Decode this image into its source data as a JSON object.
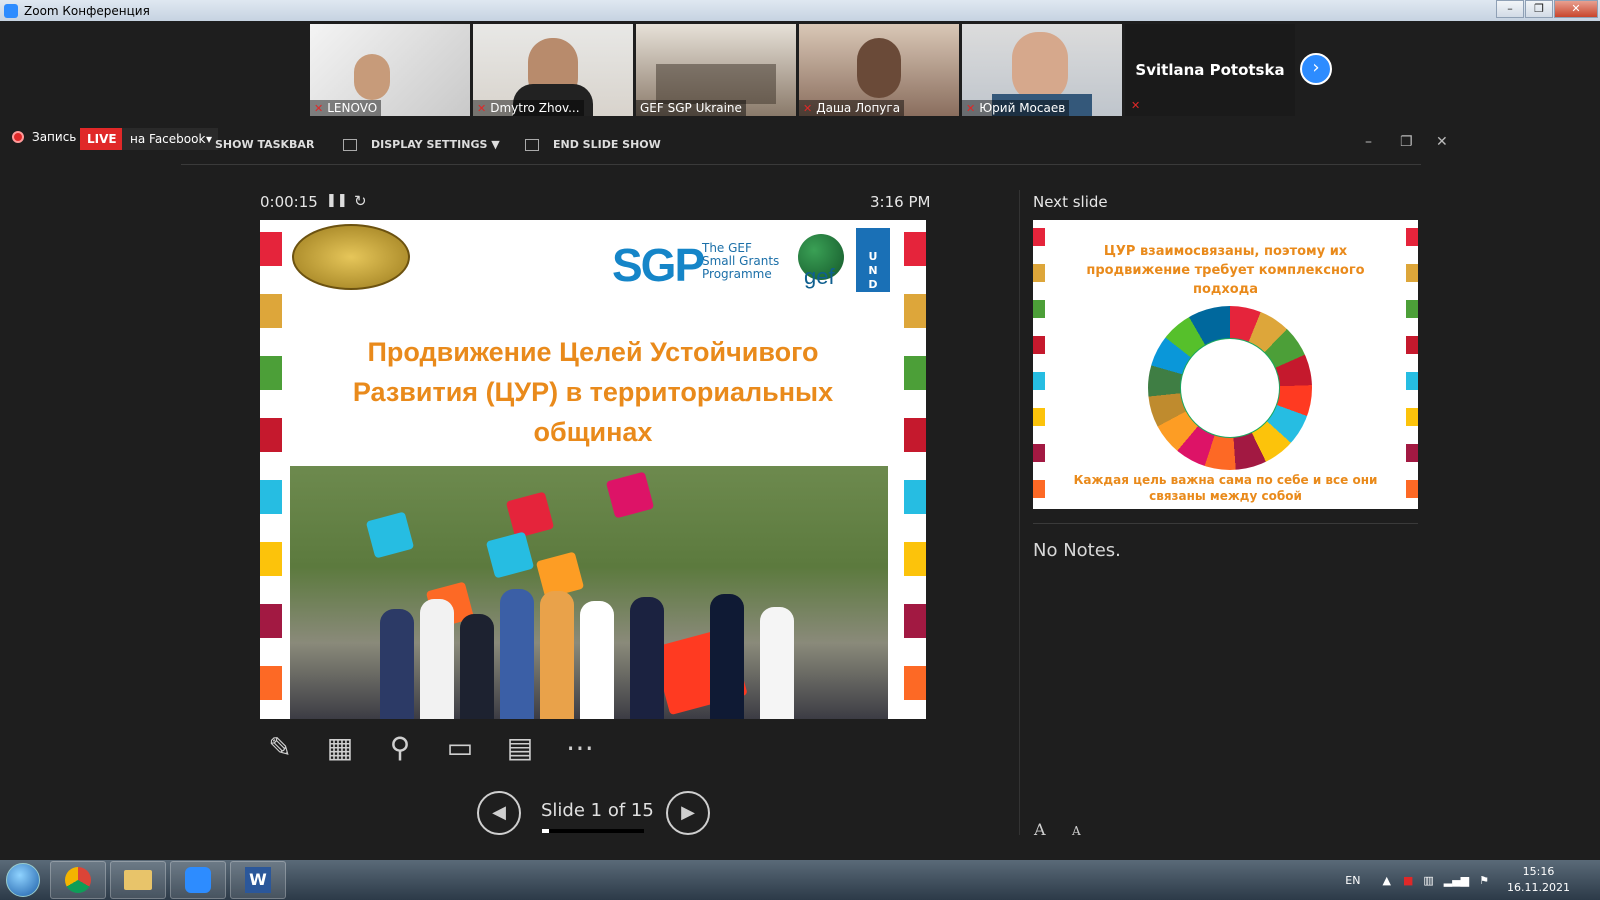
{
  "window": {
    "title": "Zoom Конференция",
    "controls": [
      "–",
      "❐",
      "✕"
    ]
  },
  "gallery": {
    "participants": [
      {
        "name": "LENOVO",
        "muted": true
      },
      {
        "name": "Dmytro Zhov...",
        "muted": true
      },
      {
        "name": "GEF SGP Ukraine",
        "muted": false
      },
      {
        "name": "Даша Лопуга",
        "muted": true
      },
      {
        "name": "Юрий Мосаев",
        "muted": true
      }
    ],
    "name_only": "Svitlana Pototska",
    "next_icon": "chevron-right-icon"
  },
  "controls": {
    "record_label": "Запись",
    "live_label": "LIVE",
    "live_target": "на Facebook",
    "show_taskbar": "SHOW TASKBAR",
    "display_settings": "DISPLAY SETTINGS ▼",
    "end_slide_show": "END SLIDE SHOW"
  },
  "presenter": {
    "timer": "0:00:15",
    "clock": "3:16 PM",
    "slide": {
      "title_lines": [
        "Продвижение Целей Устойчивого",
        "Развития (ЦУР) в территориальных",
        "общинах"
      ],
      "logos": {
        "sgp": "SGP",
        "sgp_sub": [
          "The GEF",
          "Small Grants",
          "Programme"
        ],
        "gef": "gef",
        "undp": [
          "U",
          "N",
          "D",
          "P"
        ]
      }
    },
    "slide_counter": "Slide 1 of 15",
    "progress": 0.0667,
    "next_slide_label": "Next slide",
    "next_slide": {
      "top_text": [
        "ЦУР взаимосвязаны, поэтому их",
        "продвижение требует комплексного подхода"
      ],
      "bottom_text": [
        "Каждая цель важна сама по себе и все они",
        "связаны между собой"
      ]
    },
    "notes": "No Notes.",
    "font_increase": "A",
    "font_decrease": "A",
    "tools": [
      "pen-icon",
      "see-all-slides-icon",
      "zoom-icon",
      "black-screen-icon",
      "subtitles-icon",
      "more-options-icon"
    ]
  },
  "taskbar": {
    "items": [
      "chrome-icon",
      "explorer-icon",
      "zoom-icon",
      "word-icon"
    ],
    "lang": "EN",
    "time": "15:16",
    "date": "16.11.2021"
  },
  "colors": {
    "live_red": "#e02828",
    "zoom_blue": "#2d8cff",
    "slide_title_orange": "#e98a1b",
    "sdg_stripes": [
      "#e5243b",
      "#dda63a",
      "#4c9f38",
      "#c5192d",
      "#26bde2",
      "#fcc30b",
      "#a21942",
      "#fd6925"
    ]
  }
}
